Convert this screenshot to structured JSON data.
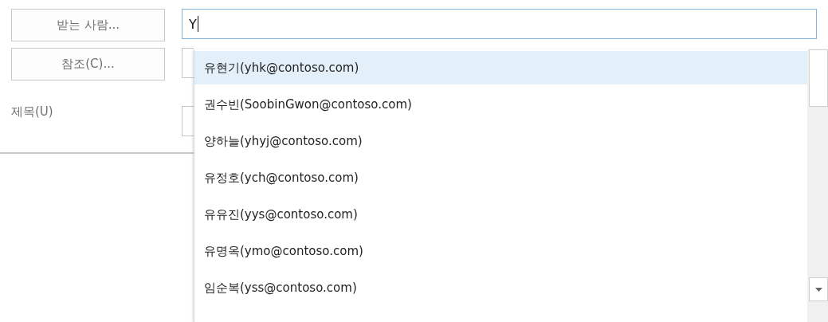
{
  "buttons": [
    {
      "label": "받는 사람..."
    },
    {
      "label": "참조(C)..."
    }
  ],
  "subject_label": "제목(U)",
  "to_field": {
    "value": "Y"
  },
  "suggestions": [
    {
      "name": "유현기",
      "email": "(yhk@contoso.com)",
      "selected": true
    },
    {
      "name": "권수빈",
      "email": "(SoobinGwon@contoso.com)",
      "selected": false
    },
    {
      "name": "양하늘",
      "email": "(yhyj@contoso.com)",
      "selected": false
    },
    {
      "name": "유정호",
      "email": "(ych@contoso.com)",
      "selected": false
    },
    {
      "name": "유유진",
      "email": "(yys@contoso.com)",
      "selected": false
    },
    {
      "name": "유명옥",
      "email": "(ymo@contoso.com)",
      "selected": false
    },
    {
      "name": "임순복",
      "email": "(yss@contoso.com)",
      "selected": false
    }
  ]
}
